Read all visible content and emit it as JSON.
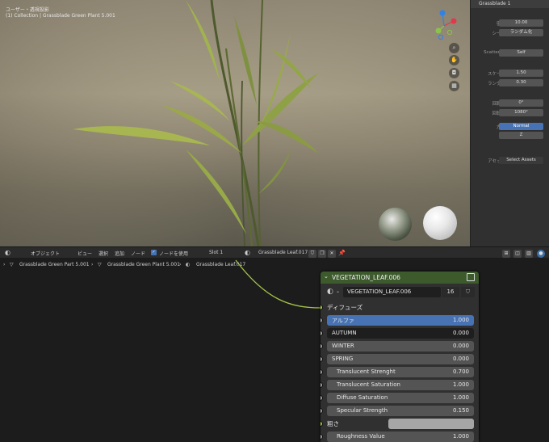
{
  "viewport": {
    "title": "ユーザー・透視投影",
    "subtitle": "(1) Collection | Grassblade Green Plant 5.001",
    "gizmo_colors": {
      "x": "#e0394e",
      "y": "#8bc34a",
      "z": "#2f82e8"
    }
  },
  "props": {
    "top_field": "Grassblade 1",
    "rows": [
      {
        "label": "密度",
        "value": "10.00",
        "style": ""
      },
      {
        "label": "シード",
        "value": "ランダム化",
        "style": "icon"
      },
      {
        "label": "Scatter E.",
        "value": "Self",
        "style": "icon"
      },
      {
        "label": "スケール",
        "value": "1.50",
        "style": ""
      },
      {
        "label": "ランダム",
        "value": "0.30",
        "style": ""
      },
      {
        "label": "回転 Y",
        "value": "0°",
        "style": ""
      },
      {
        "label": "回転 Z",
        "value": "1080°",
        "style": ""
      },
      {
        "label": "方向",
        "value": "Normal",
        "style": "blue"
      },
      {
        "label": "",
        "value": "Z",
        "style": ""
      },
      {
        "label": "アセット",
        "value": "Select Assets",
        "style": "dark"
      }
    ]
  },
  "node_header": {
    "editor_icon": "◐",
    "object_label": "オブジェクト",
    "menu": [
      "ビュー",
      "選択",
      "追加",
      "ノード"
    ],
    "use_nodes_label": "ノードを使用",
    "slot": "Slot 1",
    "material": "Grassblade Leaf.017",
    "use_nodes_checked": true
  },
  "breadcrumb": [
    "Grassblade Green Part 5.001",
    "Grassblade Green Plant 5.001",
    "Grassblade Leaf.017"
  ],
  "node": {
    "title": "VEGETATION_LEAF.006",
    "group_name": "VEGETATION_LEAF.006",
    "group_users": "16",
    "inputs": [
      {
        "name": "ディフューズ",
        "value": "",
        "kind": "label",
        "socket": "green"
      },
      {
        "name": "アルファ",
        "value": "1.000",
        "kind": "blue",
        "socket": "grey"
      },
      {
        "name": "AUTUMN",
        "value": "0.000",
        "kind": "dark",
        "socket": "grey"
      },
      {
        "name": "WINTER",
        "value": "0.000",
        "kind": "",
        "socket": "grey"
      },
      {
        "name": "SPRING",
        "value": "0.000",
        "kind": "",
        "socket": "grey"
      },
      {
        "name": "Translucent Strenght",
        "value": "0.700",
        "kind": "indent",
        "socket": "grey"
      },
      {
        "name": "Translucent Saturation",
        "value": "1.000",
        "kind": "indent",
        "socket": "grey"
      },
      {
        "name": "Diffuse Saturation",
        "value": "1.000",
        "kind": "indent",
        "socket": "grey"
      },
      {
        "name": "Specular Strength",
        "value": "0.150",
        "kind": "indent",
        "socket": "grey"
      },
      {
        "name": "粗さ",
        "value": "",
        "kind": "color",
        "socket": "green"
      },
      {
        "name": "Roughness Value",
        "value": "1.000",
        "kind": "indent",
        "socket": "grey"
      }
    ]
  }
}
